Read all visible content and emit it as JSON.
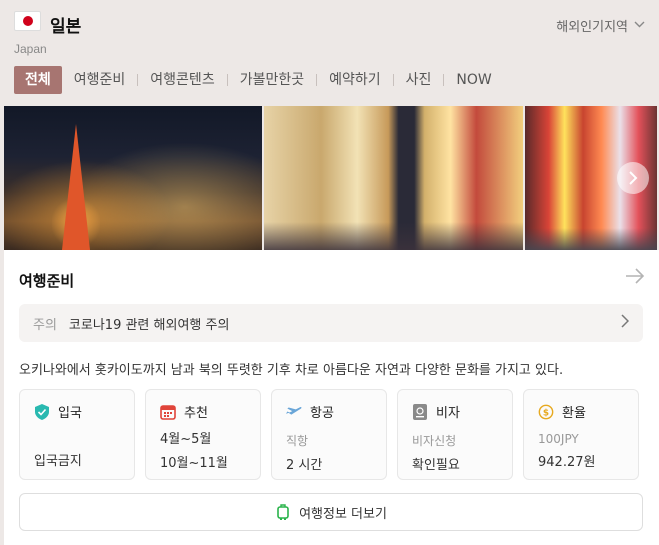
{
  "header": {
    "title": "일본",
    "subtitle": "Japan",
    "region_link": "해외인기지역"
  },
  "tabs": [
    {
      "label": "전체",
      "active": true
    },
    {
      "label": "여행준비"
    },
    {
      "label": "여행콘텐츠"
    },
    {
      "label": "가볼만한곳"
    },
    {
      "label": "예약하기"
    },
    {
      "label": "사진"
    },
    {
      "label": "NOW"
    }
  ],
  "section": {
    "title": "여행준비",
    "notice_label": "주의",
    "notice_text": "코로나19 관련 해외여행 주의",
    "description": "오키나와에서 홋카이도까지 남과 북의 뚜렷한 기후 차로 아름다운 자연과 다양한 문화를 가지고 있다."
  },
  "info": {
    "entry": {
      "label": "입국",
      "value": "입국금지"
    },
    "recommend": {
      "label": "추천",
      "line1": "4월~5월",
      "line2": "10월~11월"
    },
    "flight": {
      "label": "항공",
      "line1": "직항",
      "line2": "2 시간"
    },
    "visa": {
      "label": "비자",
      "line1": "비자신청",
      "line2": "확인필요"
    },
    "exchange": {
      "label": "환율",
      "line1": "100JPY",
      "line2": "942.27원"
    }
  },
  "more_button": "여행정보 더보기",
  "colors": {
    "active_tab": "#a77571",
    "entry_icon": "#29b9b0",
    "calendar_icon": "#e0443a",
    "plane_icon": "#6aa6d8",
    "visa_icon": "#8a8a8a",
    "coin_icon": "#e7a91f",
    "more_icon": "#2ab44b"
  }
}
